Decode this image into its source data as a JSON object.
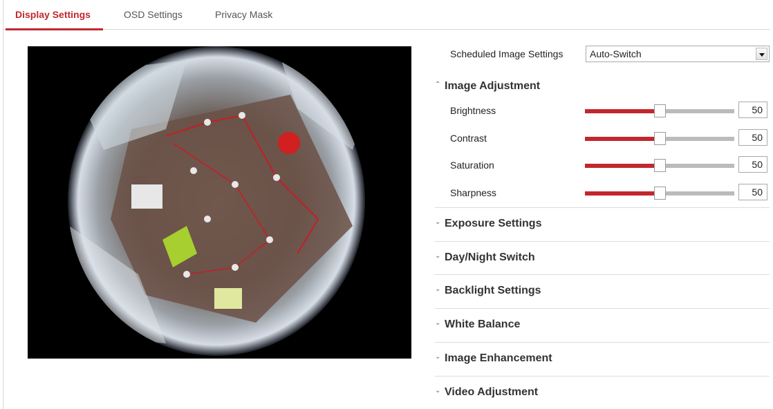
{
  "tabs": [
    {
      "label": "Display Settings",
      "active": true
    },
    {
      "label": "OSD Settings",
      "active": false
    },
    {
      "label": "Privacy Mask",
      "active": false
    }
  ],
  "settings": {
    "scheduled_label": "Scheduled Image Settings",
    "scheduled_value": "Auto-Switch",
    "image_adjustment": {
      "title": "Image Adjustment",
      "expanded": true,
      "sliders": [
        {
          "label": "Brightness",
          "value": "50",
          "fraction": 0.5
        },
        {
          "label": "Contrast",
          "value": "50",
          "fraction": 0.5
        },
        {
          "label": "Saturation",
          "value": "50",
          "fraction": 0.5
        },
        {
          "label": "Sharpness",
          "value": "50",
          "fraction": 0.5
        }
      ]
    },
    "sections": [
      "Exposure Settings",
      "Day/Night Switch",
      "Backlight Settings",
      "White Balance",
      "Image Enhancement",
      "Video Adjustment"
    ]
  },
  "colors": {
    "accent": "#c1272d",
    "track": "#bbbbbb",
    "border": "#d8d8d8"
  },
  "icons": {
    "collapse": "chevron-up-icon",
    "expand": "chevron-down-icon",
    "dropdown": "dropdown-arrow-icon"
  }
}
